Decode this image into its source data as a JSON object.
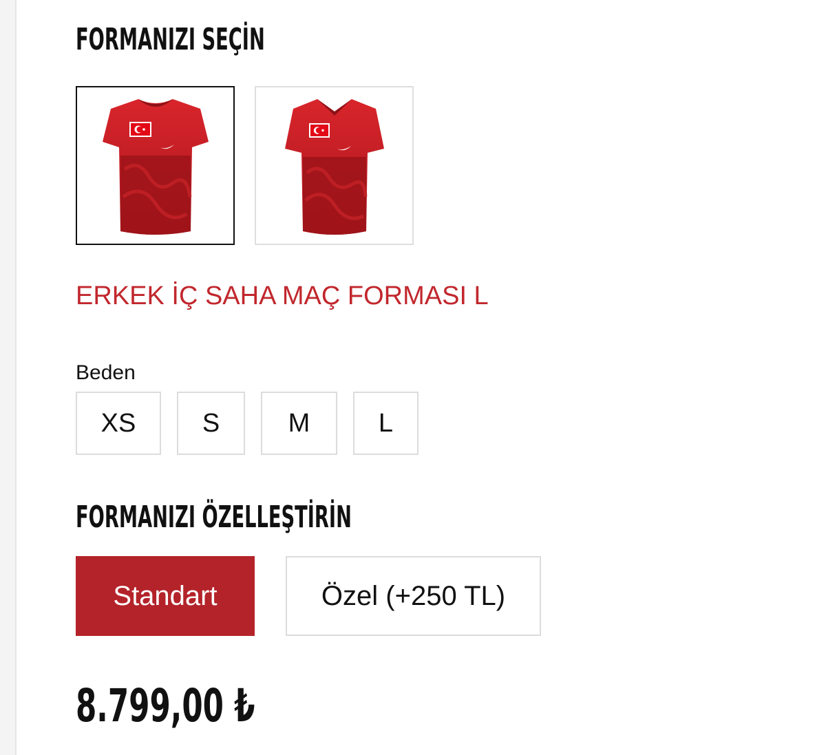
{
  "select_section": {
    "title": "FORMANIZI SEÇİN"
  },
  "jerseys": [
    {
      "name": "jersey-front-view",
      "selected": true,
      "icon": "jersey-icon"
    },
    {
      "name": "jersey-front-view-alt",
      "selected": false,
      "icon": "jersey-icon"
    }
  ],
  "product": {
    "title": "ERKEK İÇ SAHA MAÇ FORMASI L"
  },
  "size": {
    "label": "Beden",
    "options": [
      "XS",
      "S",
      "M",
      "L"
    ]
  },
  "customize_section": {
    "title": "FORMANIZI ÖZELLEŞTİRİN",
    "options": [
      "Standart",
      "Özel (+250 TL)"
    ],
    "selected": "Standart"
  },
  "price": {
    "value": "8.799,00 ₺"
  },
  "colors": {
    "accent": "#c1272d",
    "button_selected": "#b4232a",
    "jersey_red": "#d8252b",
    "jersey_dark": "#8e1218"
  }
}
